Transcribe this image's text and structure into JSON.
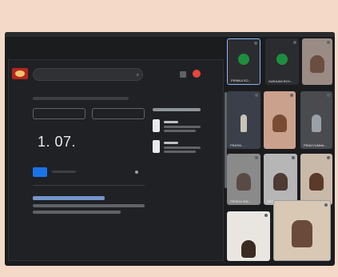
{
  "meeting": {
    "shared_screen": {
      "result_value": "1. 07."
    },
    "participants": [
      {
        "label": "PRINKA SO...",
        "avatar_color": "#1e8e3e"
      },
      {
        "label": "SURAJIM ROY...",
        "avatar_color": "#1e8e3e"
      },
      {
        "label": "",
        "avatar_color": ""
      },
      {
        "label": "PRATIK...",
        "avatar_color": ""
      },
      {
        "label": "",
        "avatar_color": ""
      },
      {
        "label": "PRADYUMNA...",
        "avatar_color": ""
      },
      {
        "label": "PRISHA SIN...",
        "avatar_color": ""
      },
      {
        "label": "DEBARGHA...",
        "avatar_color": ""
      },
      {
        "label": "",
        "avatar_color": ""
      }
    ]
  }
}
